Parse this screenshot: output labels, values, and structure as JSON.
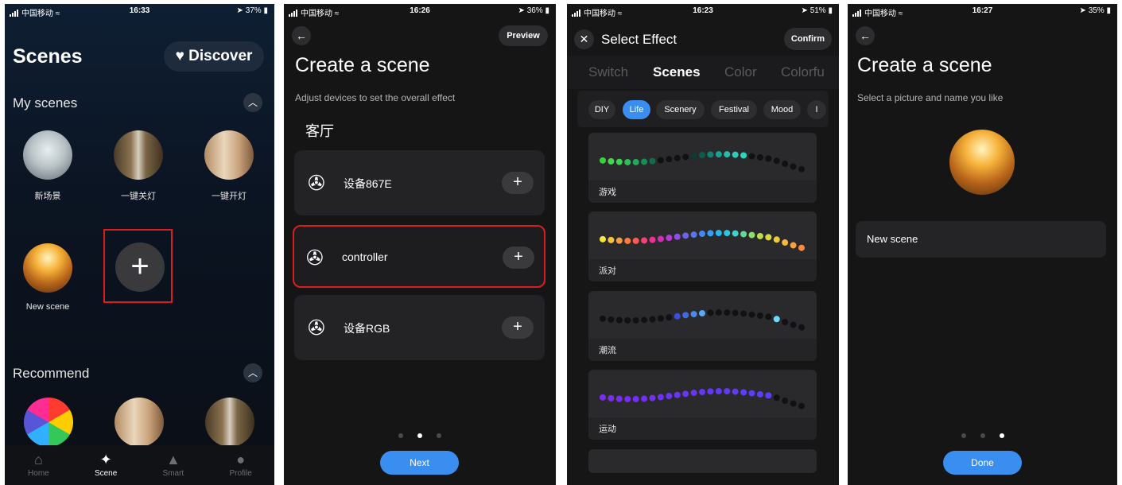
{
  "status_bars": [
    {
      "carrier": "中国移动",
      "time": "16:33",
      "battery": "37%"
    },
    {
      "carrier": "中国移动",
      "time": "16:26",
      "battery": "36%"
    },
    {
      "carrier": "中国移动",
      "time": "16:23",
      "battery": "51%"
    },
    {
      "carrier": "中国移动",
      "time": "16:27",
      "battery": "35%"
    }
  ],
  "scenes_screen": {
    "title": "Scenes",
    "discover_label": "Discover",
    "my_scenes_title": "My scenes",
    "my_scenes": [
      {
        "label": "新场景"
      },
      {
        "label": "一键关灯"
      },
      {
        "label": "一键开灯"
      },
      {
        "label": "New scene"
      }
    ],
    "recommend_title": "Recommend",
    "tabs": [
      {
        "label": "Home",
        "icon": "home-icon"
      },
      {
        "label": "Scene",
        "icon": "magic-wand-icon",
        "active": true
      },
      {
        "label": "Smart",
        "icon": "smart-icon"
      },
      {
        "label": "Profile",
        "icon": "profile-icon"
      }
    ]
  },
  "create_scene_devices": {
    "title": "Create a scene",
    "preview_label": "Preview",
    "subtitle": "Adjust devices to set the overall effect",
    "room": "客厅",
    "devices": [
      {
        "name": "设备867E"
      },
      {
        "name": "controller"
      },
      {
        "name": "设备RGB"
      }
    ],
    "next_label": "Next",
    "page_index": 1
  },
  "select_effect": {
    "title": "Select Effect",
    "confirm_label": "Confirm",
    "tabs": [
      "Switch",
      "Scenes",
      "Color",
      "Colorfu"
    ],
    "active_tab": "Scenes",
    "chips": [
      "DIY",
      "Life",
      "Scenery",
      "Festival",
      "Mood",
      "I"
    ],
    "active_chip": "Life",
    "effects": [
      {
        "label": "游戏",
        "colors": [
          "#36d33a",
          "#3ddc45",
          "#38d44e",
          "#2fbf58",
          "#23a85a",
          "#178e55",
          "#0e704a",
          "#111",
          "#111",
          "#111",
          "#111",
          "#0c3b33",
          "#0e5a4d",
          "#138071",
          "#1aa291",
          "#21bfaa",
          "#29d0b9",
          "#2ed6bf",
          "#111",
          "#111",
          "#111",
          "#111",
          "#111",
          "#111",
          "#111"
        ]
      },
      {
        "label": "派对",
        "colors": [
          "#f6e53b",
          "#f9c23a",
          "#fb9c3a",
          "#fd7a42",
          "#fd5a55",
          "#fb3f72",
          "#f12e95",
          "#d52bb7",
          "#b43bd3",
          "#8d4ee6",
          "#6e61f0",
          "#5775f3",
          "#4489f3",
          "#379ff1",
          "#2ab6ec",
          "#27c8e2",
          "#3fd2c6",
          "#62d89b",
          "#8fdc6f",
          "#b8de4d",
          "#d8dc3a",
          "#eccd39",
          "#f7b73a",
          "#fb9f3b",
          "#fd8a3d"
        ]
      },
      {
        "label": "潮流",
        "colors": [
          "#111",
          "#111",
          "#111",
          "#111",
          "#111",
          "#111",
          "#111",
          "#111",
          "#111",
          "#3b4fd8",
          "#3f6ae2",
          "#4a8af0",
          "#56abf6",
          "#111",
          "#111",
          "#111",
          "#111",
          "#111",
          "#111",
          "#111",
          "#111",
          "#6ed8ff",
          "#111",
          "#111",
          "#111"
        ]
      },
      {
        "label": "运动",
        "colors": [
          "#7b2cf2",
          "#7a2cf3",
          "#782df3",
          "#762ef4",
          "#742ff4",
          "#7230f5",
          "#7031f5",
          "#6e32f6",
          "#6c33f6",
          "#6a34f6",
          "#6935f7",
          "#6736f7",
          "#6537f7",
          "#6438f8",
          "#6239f8",
          "#613af8",
          "#5f3bf8",
          "#5e3cf9",
          "#5c3df9",
          "#5b3ef9",
          "#5a3ff9",
          "#111",
          "#111",
          "#111",
          "#111"
        ]
      }
    ]
  },
  "create_scene_name": {
    "title": "Create a scene",
    "subtitle": "Select a picture and name you like",
    "name_value": "New scene",
    "done_label": "Done",
    "page_index": 2
  },
  "colors": {
    "accent": "#3a8ef0",
    "highlight_box": "#d81e1e"
  }
}
